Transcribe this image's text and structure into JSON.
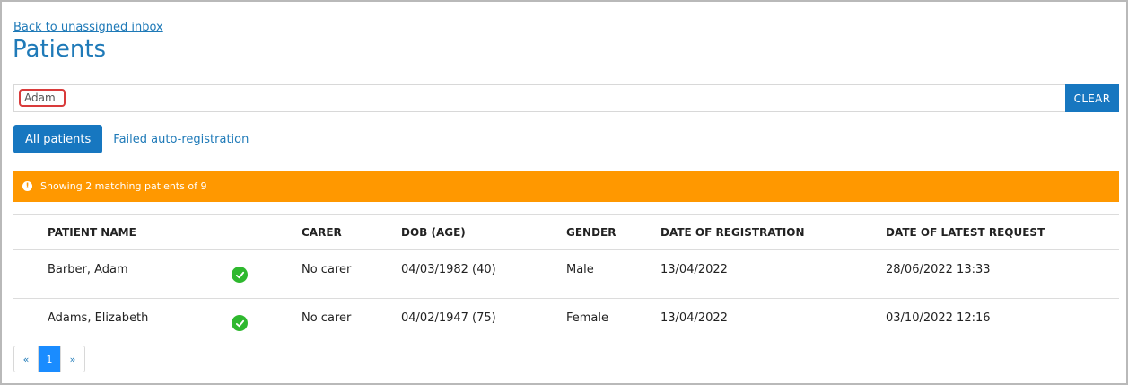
{
  "header": {
    "back_link": "Back to unassigned inbox",
    "title": "Patients"
  },
  "search": {
    "value": "Adam",
    "clear_label": "CLEAR"
  },
  "tabs": [
    {
      "label": "All patients",
      "active": true
    },
    {
      "label": "Failed auto-registration",
      "active": false
    }
  ],
  "alert": {
    "text": "Showing 2 matching patients of 9",
    "color": "#ff9800",
    "icon": "info-icon"
  },
  "table": {
    "columns": [
      "PATIENT NAME",
      "CARER",
      "DOB (AGE)",
      "GENDER",
      "DATE OF REGISTRATION",
      "DATE OF LATEST REQUEST"
    ],
    "rows": [
      {
        "name": "Barber, Adam",
        "status_icon": "check-circle-icon",
        "carer": "No carer",
        "dob": "04/03/1982 (40)",
        "gender": "Male",
        "registered": "13/04/2022",
        "latest_request": "28/06/2022 13:33"
      },
      {
        "name": "Adams, Elizabeth",
        "status_icon": "check-circle-icon",
        "carer": "No carer",
        "dob": "04/02/1947 (75)",
        "gender": "Female",
        "registered": "13/04/2022",
        "latest_request": "03/10/2022 12:16"
      }
    ]
  },
  "pagination": {
    "prev": "«",
    "current": "1",
    "next": "»"
  },
  "colors": {
    "primary": "#1777c0",
    "link": "#1f7ab8",
    "success": "#2eb82e",
    "warning": "#ff9800"
  }
}
